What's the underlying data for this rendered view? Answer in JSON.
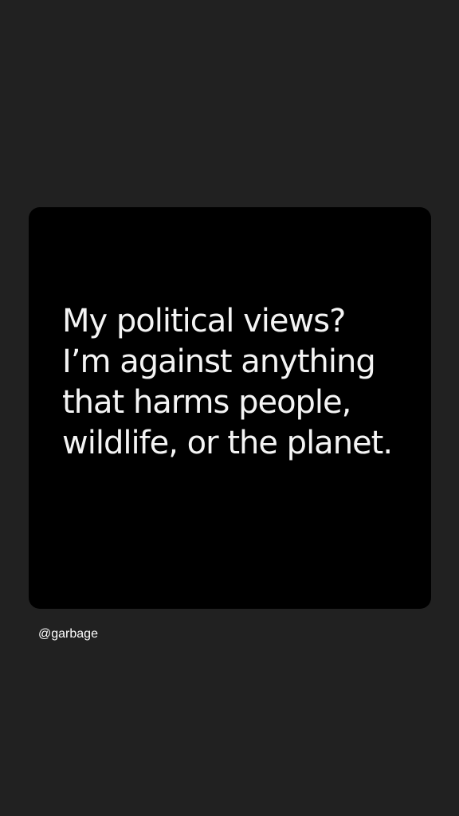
{
  "post": {
    "quote_lines": [
      "My political views?",
      "I’m against anything",
      "that harms people,",
      "wildlife, or the planet."
    ],
    "attribution": "@garbage"
  },
  "colors": {
    "page_background": "#212121",
    "card_background": "#000000",
    "text": "#f4f4f4"
  }
}
